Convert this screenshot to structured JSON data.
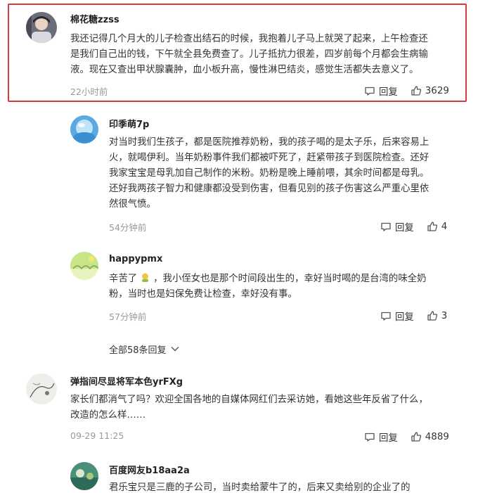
{
  "comments": [
    {
      "username": "棉花糖zzss",
      "lines": [
        "我还记得几个月大的儿子检查出结石的时候，我抱着儿子马上就哭了起来，上午检查还",
        "是我们自己出的钱，下午就全县免费查了。儿子抵抗力很差，四岁前每个月都会生病输",
        "液。现在又查出甲状腺囊肿，血小板升高，慢性淋巴结炎，感觉生活都失去意义了。"
      ],
      "time": "22小时前",
      "reply_label": "回复",
      "likes": "3629"
    },
    {
      "username": "印季萌7p",
      "lines": [
        "对当时我们生孩子，都是医院推荐奶粉，我的孩子喝的是太子乐，后来容易上",
        "火，就喝伊利。当年奶粉事件我们都被吓死了，赶紧带孩子到医院检查。还好",
        "我家宝宝是母乳加自己制作的米粉。奶粉是晚上睡前喂，其余时间都是母乳。",
        "还好我两孩子智力和健康都没受到伤害，但看见别的孩子伤害这么严重心里依",
        "然很气愤。"
      ],
      "time": "54分钟前",
      "reply_label": "回复",
      "likes": "4"
    },
    {
      "username": "happypmx",
      "line1_before": "辛苦了",
      "line1_after": "，我小侄女也是那个时间段出生的，幸好当时喝的是台湾的味全奶",
      "line2": "粉，当时也是妇保免费让检查，幸好没有事。",
      "time": "57分钟前",
      "reply_label": "回复",
      "likes": "3"
    },
    {
      "username": "弹指间尽显将军本色yrFXg",
      "lines": [
        "家长们都消气了吗？欢迎全国各地的自媒体网红们去采访她，看她这些年反省了什么，",
        "改造的怎么样……"
      ],
      "time": "09-29 11:25",
      "reply_label": "回复",
      "likes": "4889"
    },
    {
      "username": "百度网友b18aa2a",
      "lines": [
        "君乐宝只是三鹿的子公司，当时卖给蒙牛了的，后来又卖给别的企业了的"
      ]
    }
  ],
  "more_replies": "全部58条回复",
  "colors": {
    "highlight_border": "#d93a3a",
    "meta_text": "#999999",
    "body_text": "#333333"
  }
}
